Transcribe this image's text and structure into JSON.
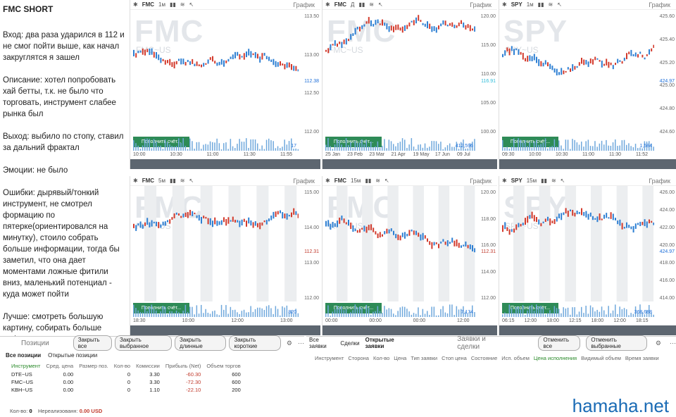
{
  "notes": {
    "title": "FMC SHORT",
    "paragraphs": [
      "Вход: два раза ударился в 112 и не смог пойти выше, как начал закруглятся я зашел",
      "Описание: хотел попробовать хай бетты, т.к. не было что торговать, инструмент слабее рынка был",
      "Выход: выбило по стопу, ставил за дальний фрактал",
      "Эмоции: не было",
      "Ошибки: дырявый/тонкий инструмент, не смотрел формацию по пятерке(ориентировался на минутку), стоило собрать больше информации, тогда бы заметил, что она дает моментами ложные фитили вниз, маленький потенциал - куда может пойти",
      "Лучше: смотреть большую картину, собирать больше информации перед входом, брать ликвидные инструменты"
    ]
  },
  "panels": [
    {
      "symbol": "FMC",
      "tf": "1м",
      "title": "График",
      "wm": "FMC",
      "wm2": "FMC~US",
      "yticks": [
        "113.50",
        "113.00",
        "112.50",
        "112.00"
      ],
      "last": "112.38",
      "last_color": "#1e6fd9",
      "fill_label": "Пополнить счёт...",
      "vol": "17",
      "xticks": [
        "10:00",
        "10:30",
        "11:00",
        "11:30",
        "11:55"
      ]
    },
    {
      "symbol": "FMC",
      "tf": "Д",
      "title": "График",
      "wm": "FMC",
      "wm2": "FMC~US",
      "yticks": [
        "120.00",
        "115.00",
        "110.00",
        "105.00",
        "100.00"
      ],
      "last": "116.91",
      "last2": "112.56",
      "last3": "112.31",
      "last_color": "#2bbbd8",
      "fill_label": "Пополнить счёт...",
      "vol": "412,596",
      "xticks": [
        "25 Jan",
        "23 Feb",
        "23 Mar",
        "21 Apr",
        "19 May",
        "17 Jun",
        "09 Jul"
      ]
    },
    {
      "symbol": "SPY",
      "tf": "1м",
      "title": "График",
      "wm": "SPY",
      "wm2": "SPY~US",
      "yticks": [
        "425.60",
        "425.40",
        "425.20",
        "425.00",
        "424.80",
        "424.60"
      ],
      "last": "424.97",
      "last_color": "#1e6fd9",
      "fill_label": "Пополнить счёт...",
      "vol": "1,584",
      "xticks": [
        "09:30",
        "10:00",
        "10:30",
        "11:00",
        "11:30",
        "11:52"
      ]
    },
    {
      "symbol": "FMC",
      "tf": "5м",
      "title": "График",
      "wm": "FMC",
      "wm2": "FMC~US",
      "yticks": [
        "115.00",
        "114.00",
        "113.00",
        "112.00"
      ],
      "last": "112.31",
      "last_color": "#c0392b",
      "fill_label": "Пополнить счёт...",
      "vol": "820",
      "xticks": [
        "18:30",
        "10:00",
        "12:00",
        "13:00"
      ]
    },
    {
      "symbol": "FMC",
      "tf": "15м",
      "title": "График",
      "wm": "FMC",
      "wm2": "FMC~US",
      "yticks": [
        "120.00",
        "118.00",
        "116.00",
        "114.00",
        "112.00"
      ],
      "last": "112.31",
      "last_color": "#c0392b",
      "fill_label": "Пополнить счёт...",
      "vol": "7,174",
      "xticks": [
        "00:00",
        "00:00",
        "00:00",
        "12:00"
      ]
    },
    {
      "symbol": "SPY",
      "tf": "15м",
      "title": "График",
      "wm": "SPY",
      "wm2": "SPY~US",
      "yticks": [
        "426.00",
        "424.00",
        "422.00",
        "420.00",
        "418.00",
        "416.00",
        "414.00"
      ],
      "last": "424.97",
      "last_color": "#1e6fd9",
      "fill_label": "Пополнить счёт...",
      "vol": "368,688",
      "xticks": [
        "06:15",
        "12:00",
        "18:00",
        "12:15",
        "18:00",
        "12:00",
        "18:15"
      ]
    }
  ],
  "positions": {
    "label": "Позиции",
    "buttons": [
      "Закрыть все",
      "Закрыть выбранное",
      "Закрыть длинные",
      "Закрыть короткие"
    ],
    "tabs": [
      "Все позиции",
      "Открытые позиции"
    ],
    "columns": [
      "Инструмент",
      "Сред. цена",
      "Размер поз.",
      "Кол-во",
      "Комиссии",
      "Прибыль (Net)",
      "Объем торгов"
    ],
    "rows": [
      [
        "DTE~US",
        "0.00",
        "",
        "0",
        "3.30",
        "-60.30",
        "600"
      ],
      [
        "FMC~US",
        "0.00",
        "",
        "0",
        "3.30",
        "-72.30",
        "600"
      ],
      [
        "KBH~US",
        "0.00",
        "",
        "0",
        "1.10",
        "-22.10",
        "200"
      ]
    ],
    "foot_qty_label": "Кол-во:",
    "foot_qty": "0",
    "foot_unreal_label": "Нереализованн:",
    "foot_unreal": "0.00 USD"
  },
  "orders": {
    "tabs": [
      "Все заявки",
      "Сделки",
      "Открытые заявки"
    ],
    "label": "Заявки и сделки",
    "buttons": [
      "Отменить все",
      "Отменить выбранные"
    ],
    "columns": [
      "Инструмент",
      "Сторона",
      "Кол-во",
      "Цена",
      "Тип заявки",
      "Стоп цена",
      "Состояние",
      "Исп. объем",
      "Цена исполнения",
      "Видимый объем",
      "Время заявки"
    ]
  },
  "brand": "hamaha.net"
}
